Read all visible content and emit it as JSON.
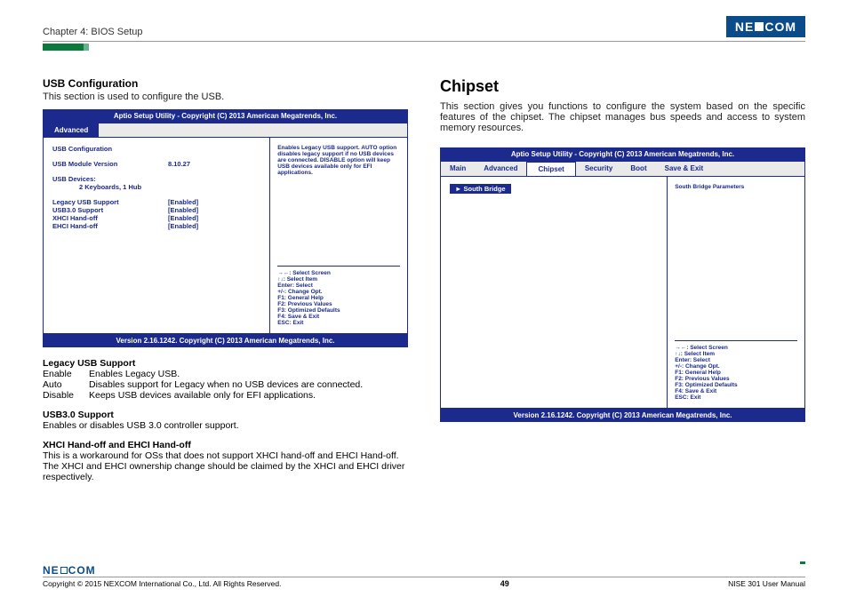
{
  "header": {
    "chapter": "Chapter 4: BIOS Setup",
    "logo_left": "NE",
    "logo_right": "COM"
  },
  "left": {
    "title": "USB Configuration",
    "intro": "This section is used to configure the USB.",
    "bios": {
      "header": "Aptio Setup Utility - Copyright (C) 2013 American Megatrends, Inc.",
      "menu": {
        "advanced": "Advanced"
      },
      "section_title": "USB Configuration",
      "module_label": "USB Module Version",
      "module_value": "8.10.27",
      "devices_label": "USB Devices:",
      "devices_value": "2 Keyboards, 1 Hub",
      "opts": [
        {
          "label": "Legacy USB Support",
          "value": "[Enabled]"
        },
        {
          "label": "USB3.0 Support",
          "value": "[Enabled]"
        },
        {
          "label": "XHCI Hand-off",
          "value": "[Enabled]"
        },
        {
          "label": "EHCI Hand-off",
          "value": "[Enabled]"
        }
      ],
      "hint": "Enables Legacy USB support. AUTO option disables legacy support if no USB devices are connected. DISABLE option will keep USB devices available only for EFI applications.",
      "nav": "→←: Select Screen\n↑↓: Select Item\nEnter: Select\n+/-: Change Opt.\nF1: General Help\nF2: Previous Values\nF3: Optimized Defaults\nF4: Save & Exit\nESC: Exit",
      "footer": "Version 2.16.1242. Copyright (C) 2013 American Megatrends, Inc."
    },
    "desc": {
      "legacy_t": "Legacy USB Support",
      "legacy_rows": [
        {
          "k": "Enable",
          "v": "Enables Legacy USB."
        },
        {
          "k": "Auto",
          "v": "Disables support for Legacy when no USB devices are connected."
        },
        {
          "k": "Disable",
          "v": "Keeps USB devices available only for EFI applications."
        }
      ],
      "usb30_t": "USB3.0 Support",
      "usb30_v": "Enables or disables USB 3.0 controller support.",
      "xhci_t": "XHCI Hand-off and EHCI Hand-off",
      "xhci_v": "This is a workaround for OSs that does not support XHCI hand-off and EHCI Hand-off. The XHCI and EHCI ownership change should be claimed by the XHCI and EHCI driver respectively."
    }
  },
  "right": {
    "title": "Chipset",
    "intro": "This section gives you functions to configure the system based on the specific features of the chipset. The chipset manages bus speeds and access to system memory resources.",
    "bios": {
      "header": "Aptio Setup Utility - Copyright (C) 2013 American Megatrends, Inc.",
      "menu": {
        "main": "Main",
        "advanced": "Advanced",
        "chipset": "Chipset",
        "security": "Security",
        "boot": "Boot",
        "save": "Save & Exit"
      },
      "item": "► South Bridge",
      "hint": "South Bridge Parameters",
      "nav": "→←: Select Screen\n↑↓: Select Item\nEnter: Select\n+/-: Change Opt.\nF1: General Help\nF2: Previous Values\nF3: Optimized Defaults\nF4: Save & Exit\nESC: Exit",
      "footer": "Version 2.16.1242. Copyright (C) 2013 American Megatrends, Inc."
    }
  },
  "footer": {
    "logo_left": "NE",
    "logo_right": "COM",
    "copyright": "Copyright © 2015 NEXCOM International Co., Ltd. All Rights Reserved.",
    "page": "49",
    "manual": "NISE 301 User Manual"
  }
}
